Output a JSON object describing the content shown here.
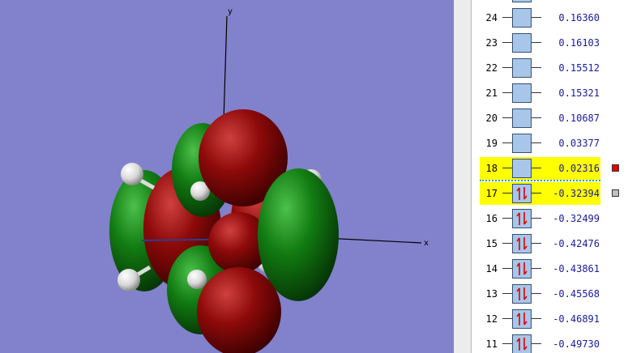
{
  "viewport": {
    "background": "#8181cc",
    "axes": {
      "y_label": "y",
      "x_label": "x"
    },
    "orbital_colors": {
      "positive": "#8a0000",
      "negative": "#0f7a0f"
    }
  },
  "mo_panel": {
    "orbitals": [
      {
        "number": "",
        "energy": "",
        "occupied": false,
        "highlighted": false,
        "marker": ""
      },
      {
        "number": "24",
        "energy": "0.16360",
        "occupied": false,
        "highlighted": false,
        "marker": ""
      },
      {
        "number": "23",
        "energy": "0.16103",
        "occupied": false,
        "highlighted": false,
        "marker": ""
      },
      {
        "number": "22",
        "energy": "0.15512",
        "occupied": false,
        "highlighted": false,
        "marker": ""
      },
      {
        "number": "21",
        "energy": "0.15321",
        "occupied": false,
        "highlighted": false,
        "marker": ""
      },
      {
        "number": "20",
        "energy": "0.10687",
        "occupied": false,
        "highlighted": false,
        "marker": ""
      },
      {
        "number": "19",
        "energy": "0.03377",
        "occupied": false,
        "highlighted": false,
        "marker": ""
      },
      {
        "number": "18",
        "energy": "0.02316",
        "occupied": false,
        "highlighted": true,
        "marker": "#e00000"
      },
      {
        "number": "17",
        "energy": "-0.32394",
        "occupied": true,
        "highlighted": true,
        "marker": "#c0c0c0"
      },
      {
        "number": "16",
        "energy": "-0.32499",
        "occupied": true,
        "highlighted": false,
        "marker": ""
      },
      {
        "number": "15",
        "energy": "-0.42476",
        "occupied": true,
        "highlighted": false,
        "marker": ""
      },
      {
        "number": "14",
        "energy": "-0.43861",
        "occupied": true,
        "highlighted": false,
        "marker": ""
      },
      {
        "number": "13",
        "energy": "-0.45568",
        "occupied": true,
        "highlighted": false,
        "marker": ""
      },
      {
        "number": "12",
        "energy": "-0.46891",
        "occupied": true,
        "highlighted": false,
        "marker": ""
      },
      {
        "number": "11",
        "energy": "-0.49730",
        "occupied": true,
        "highlighted": false,
        "marker": ""
      }
    ]
  }
}
